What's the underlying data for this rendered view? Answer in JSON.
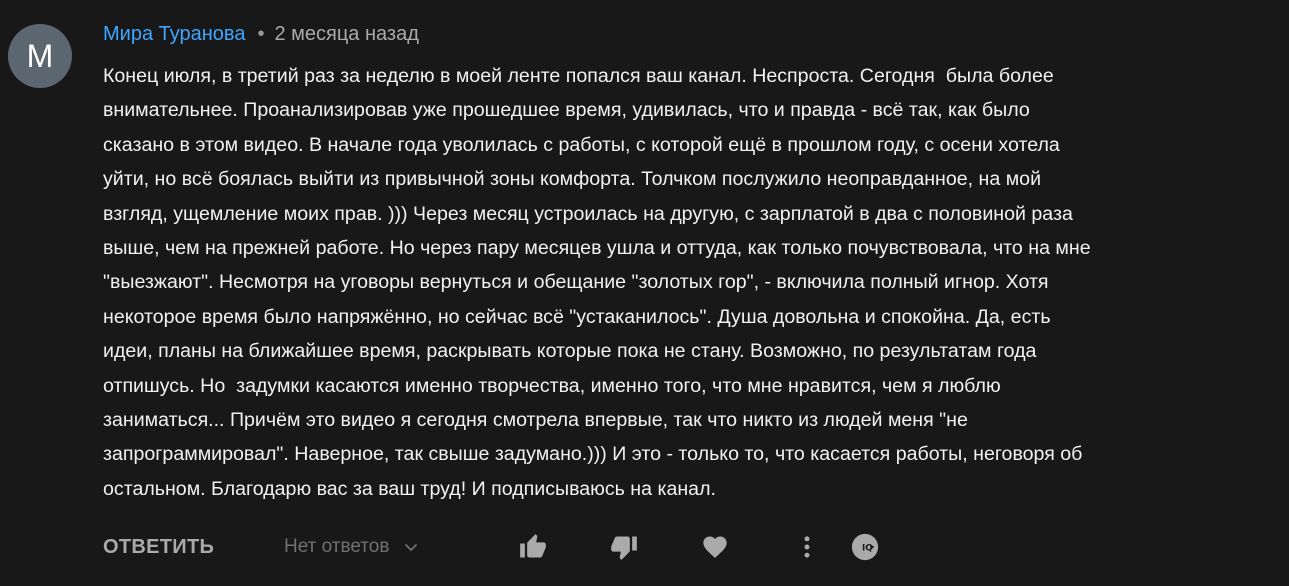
{
  "comment": {
    "avatar_letter": "M",
    "author": "Мира Туранова",
    "separator": "•",
    "time": "2 месяца назад",
    "text_lines": [
      "Конец июля, в третий раз за неделю в моей ленте попался ваш канал. Неспроста. Сегодня  была более",
      "внимательнее. Проанализировав уже прошедшее время, удивилась, что и правда - всё так, как было",
      "сказано в этом видео. В начале года уволилась с работы, с которой ещё в прошлом году, с осени хотела",
      "уйти, но всё боялась выйти из привычной зоны комфорта. Толчком послужило неоправданное, на мой",
      "взгляд, ущемление моих прав. ))) Через месяц устроилась на другую, с зарплатой в два с половиной раза",
      "выше, чем на прежней работе. Но через пару месяцев ушла и оттуда, как только почувствовала, что на мне",
      "\"выезжают\". Несмотря на уговоры вернуться и обещание \"золотых гор\", - включила полный игнор. Хотя",
      "некоторое время было напряжённо, но сейчас всё \"устаканилось\". Душа довольна и спокойна. Да, есть",
      "идеи, планы на ближайшее время, раскрывать которые пока не стану. Возможно, по результатам года",
      "отпишусь. Но  задумки касаются именно творчества, именно того, что мне нравится, чем я люблю",
      "заниматься... Причём это видео я сегодня смотрела впервые, так что никто из людей меня \"не",
      "запрограммировал\". Наверное, так свыше задумано.))) И это - только то, что касается работы, неговоря об",
      "остальном. Благодарю вас за ваш труд! И подписываюсь на канал."
    ]
  },
  "actions": {
    "reply_label": "ОТВЕТИТЬ",
    "replies_label": "Нет ответов",
    "icons": [
      "chevron-down-icon",
      "thumbs-up-icon",
      "thumbs-down-icon",
      "heart-icon",
      "more-vert-icon",
      "share-icon"
    ]
  },
  "colors": {
    "background": "#181818",
    "author": "#3ea6ff",
    "text": "#f1f1f1",
    "muted": "#aaaaaa",
    "avatar": "#5b6670"
  }
}
